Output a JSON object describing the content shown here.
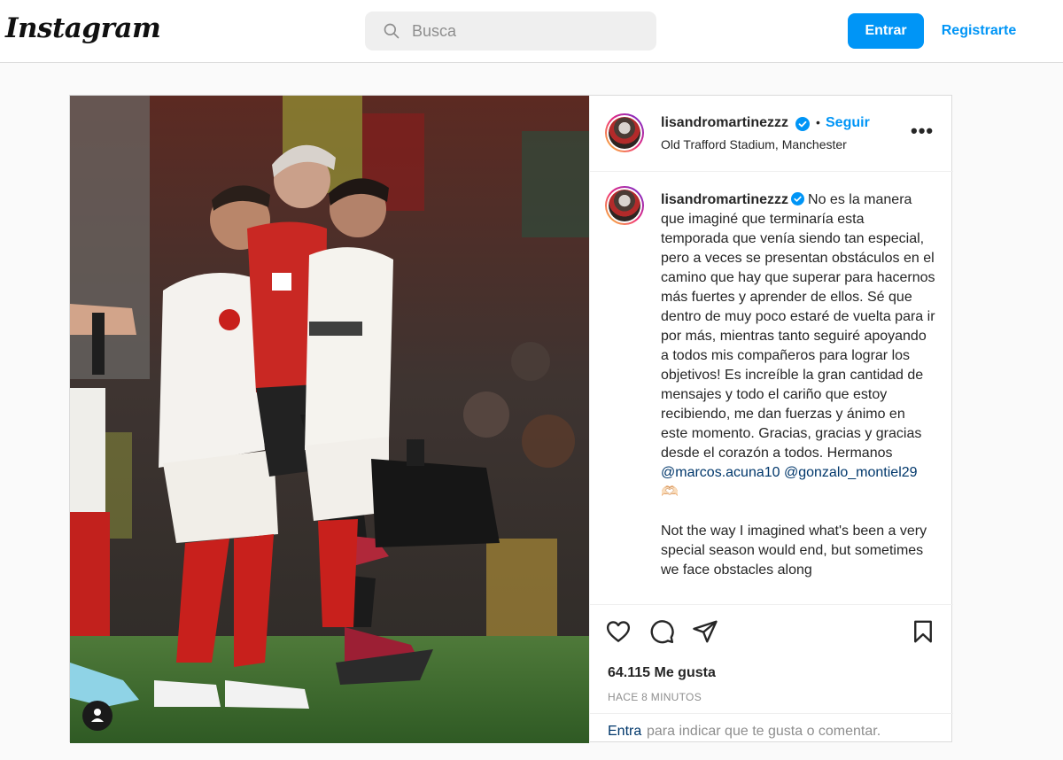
{
  "header": {
    "logo": "Instagram",
    "search_placeholder": "Busca",
    "login_label": "Entrar",
    "signup_label": "Registrarte"
  },
  "post": {
    "username": "lisandromartinezzz",
    "follow_label": "Seguir",
    "location": "Old Trafford Stadium, Manchester",
    "more_label": "•••",
    "caption_lines": [
      "No es la manera que imaginé que terminaría esta temporada que venía siendo tan especial, pero a veces se presentan obstáculos en el camino que hay que superar para hacernos más fuertes y aprender de ellos. Sé que dentro de muy poco estaré de vuelta para ir por más, mientras tanto seguiré apoyando a todos mis compañeros para lograr los objetivos! Es increíble la gran cantidad de mensajes y todo el cariño que estoy recibiendo, me dan fuerzas y ánimo en este momento. Gracias, gracias y gracias desde el corazón a todos. Hermanos"
    ],
    "mentions": [
      "@marcos.acuna10",
      "@gonzalo_montiel29"
    ],
    "emoji": "🫶🏻",
    "caption_english": "Not the way I imagined what's been a very special season would end, but sometimes we face obstacles along",
    "likes": "64.115 Me gusta",
    "timestamp": "HACE 8 MINUTOS",
    "login_link": "Entra",
    "login_rest": "para indicar que te gusta o comentar."
  },
  "icons": {
    "search": "search-icon",
    "verified": "verified-badge-icon",
    "like": "heart-icon",
    "comment": "comment-icon",
    "share": "share-icon",
    "save": "bookmark-icon",
    "tag": "user-tag-icon"
  },
  "colors": {
    "accent": "#0095f6",
    "mention": "#00376b",
    "muted": "#8e8e8e"
  }
}
